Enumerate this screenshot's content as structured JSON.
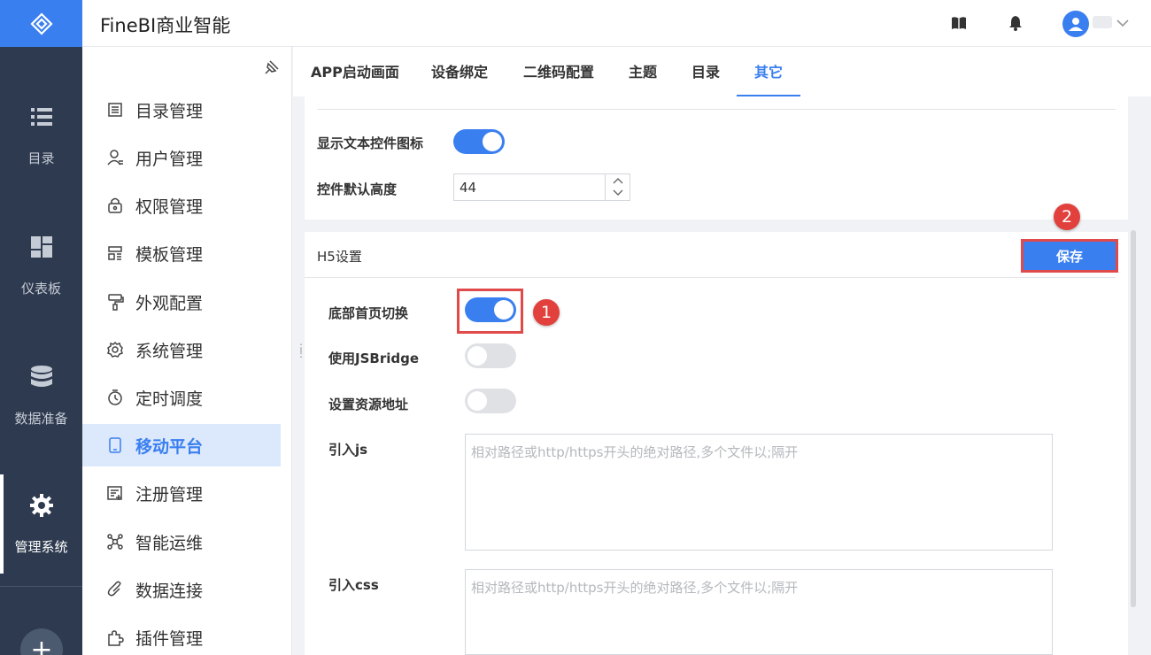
{
  "app": {
    "title": "FineBI商业智能"
  },
  "leftnav": {
    "items": [
      {
        "label": "目录",
        "icon": "list-icon"
      },
      {
        "label": "仪表板",
        "icon": "dashboard-icon"
      },
      {
        "label": "数据准备",
        "icon": "database-icon"
      },
      {
        "label": "管理系统",
        "icon": "gear-icon",
        "active": true
      }
    ],
    "add_label": "+"
  },
  "sidebar": {
    "items": [
      {
        "label": "目录管理",
        "icon": "catalog-icon"
      },
      {
        "label": "用户管理",
        "icon": "user-icon"
      },
      {
        "label": "权限管理",
        "icon": "lock-icon"
      },
      {
        "label": "模板管理",
        "icon": "template-icon"
      },
      {
        "label": "外观配置",
        "icon": "brush-icon"
      },
      {
        "label": "系统管理",
        "icon": "settings-icon"
      },
      {
        "label": "定时调度",
        "icon": "timer-icon"
      },
      {
        "label": "移动平台",
        "icon": "mobile-icon",
        "active": true
      },
      {
        "label": "注册管理",
        "icon": "register-icon"
      },
      {
        "label": "智能运维",
        "icon": "network-icon"
      },
      {
        "label": "数据连接",
        "icon": "link-icon"
      },
      {
        "label": "插件管理",
        "icon": "plugin-icon"
      }
    ]
  },
  "tabs": [
    {
      "label": "APP启动画面"
    },
    {
      "label": "设备绑定"
    },
    {
      "label": "二维码配置"
    },
    {
      "label": "主题"
    },
    {
      "label": "目录"
    },
    {
      "label": "其它",
      "active": true
    }
  ],
  "panel1": {
    "show_text_icon_label": "显示文本控件图标",
    "show_text_icon_on": true,
    "default_height_label": "控件默认高度",
    "default_height_value": "44"
  },
  "h5": {
    "title": "H5设置",
    "save_label": "保存",
    "bottom_home_switch_label": "底部首页切换",
    "bottom_home_switch_on": true,
    "jsbridge_label": "使用JSBridge",
    "jsbridge_on": false,
    "resource_addr_label": "设置资源地址",
    "resource_addr_on": false,
    "import_js_label": "引入js",
    "import_js_placeholder": "相对路径或http/https开头的绝对路径,多个文件以;隔开",
    "import_css_label": "引入css",
    "import_css_placeholder": "相对路径或http/https开头的绝对路径,多个文件以;隔开"
  },
  "annotations": {
    "badge1": "1",
    "badge2": "2"
  },
  "colors": {
    "accent": "#3a7ff0",
    "nav_bg": "#2e3a4f",
    "highlight": "#e04a4a"
  }
}
